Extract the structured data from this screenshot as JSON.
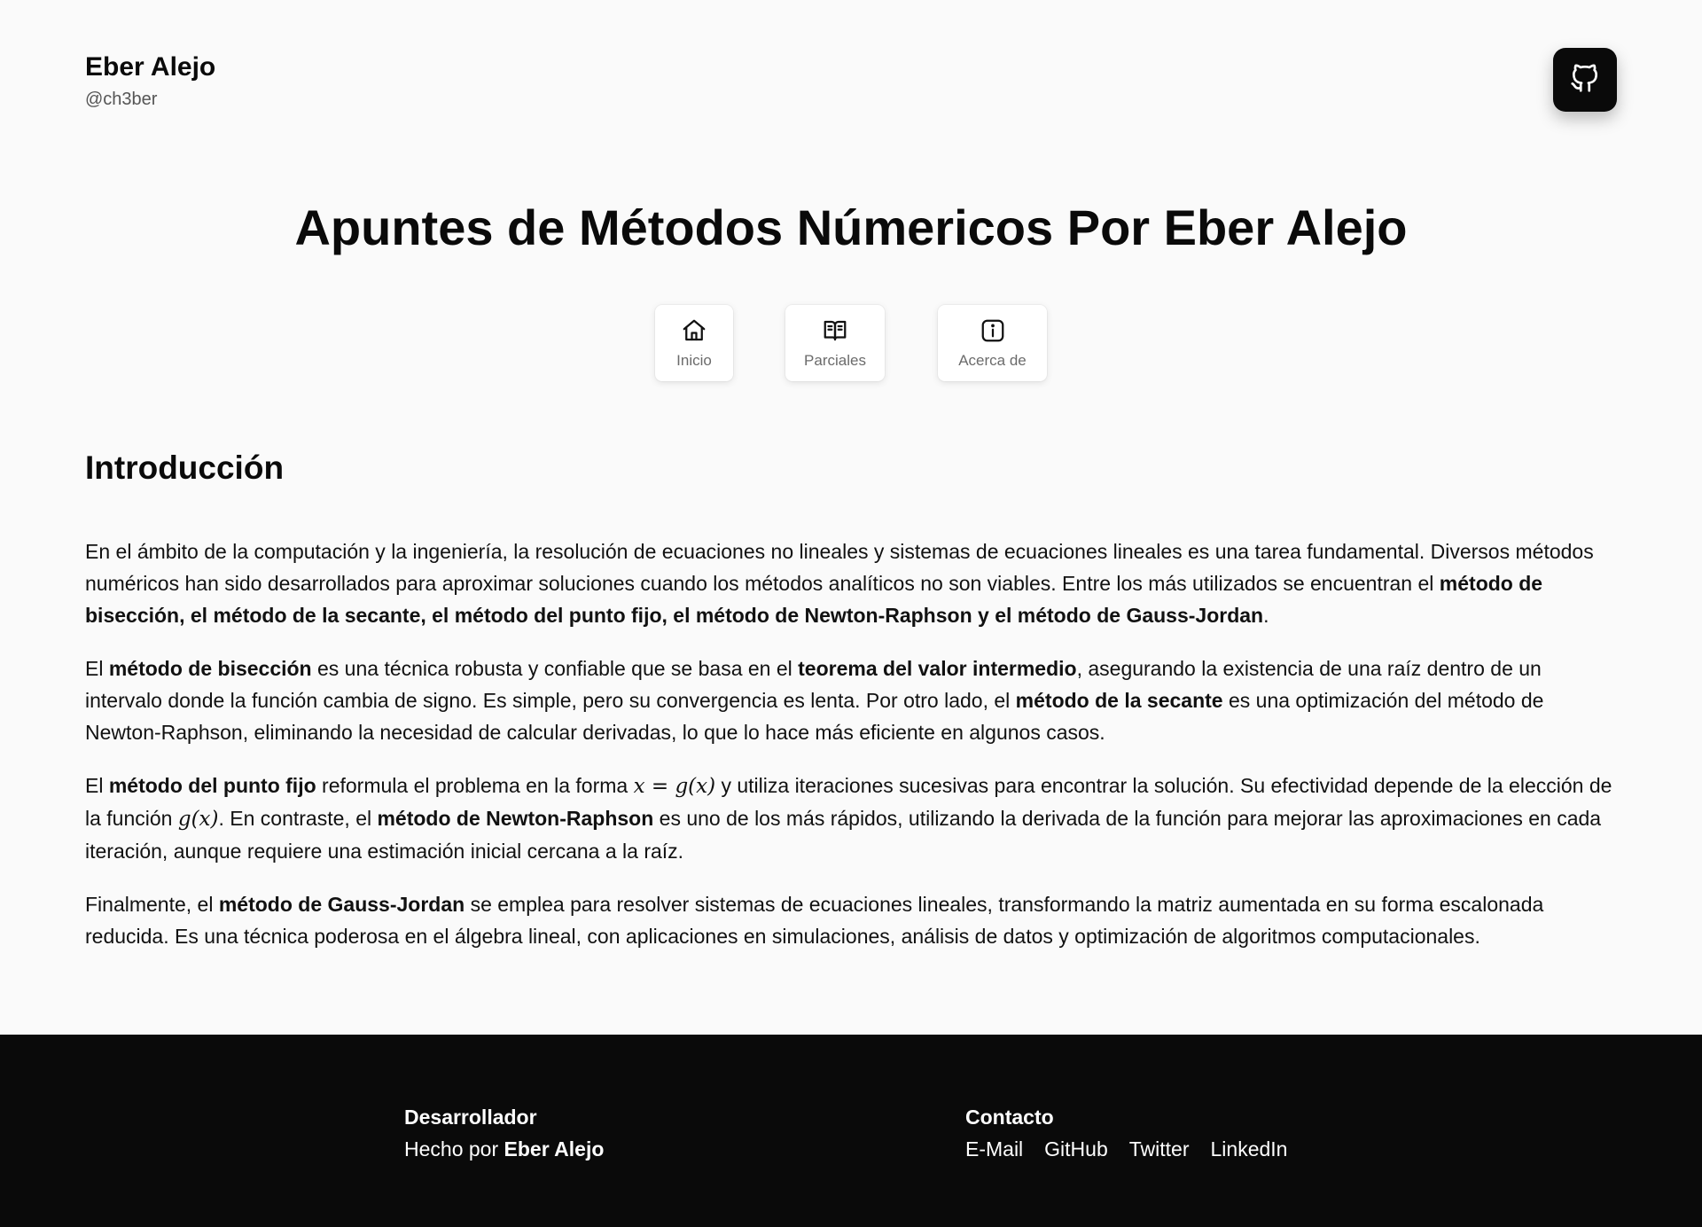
{
  "header": {
    "name": "Eber Alejo",
    "handle": "@ch3ber",
    "github_icon": "github-icon"
  },
  "hero": {
    "title": "Apuntes de Métodos Númericos Por Eber Alejo"
  },
  "nav": {
    "items": [
      {
        "label": "Inicio",
        "icon": "home-icon"
      },
      {
        "label": "Parciales",
        "icon": "book-open-icon"
      },
      {
        "label": "Acerca de",
        "icon": "info-icon"
      }
    ]
  },
  "intro": {
    "title": "Introducción",
    "p1": {
      "t1": "En el ámbito de la computación y la ingeniería, la resolución de ecuaciones no lineales y sistemas de ecuaciones lineales es una tarea fundamental. Diversos métodos numéricos han sido desarrollados para aproximar soluciones cuando los métodos analíticos no son viables. Entre los más utilizados se encuentran el ",
      "b1": "método de bisección, el método de la secante, el método del punto fijo, el método de Newton-Raphson y el método de Gauss-Jordan",
      "t2": "."
    },
    "p2": {
      "t1": "El ",
      "b1": "método de bisección",
      "t2": " es una técnica robusta y confiable que se basa en el ",
      "b2": "teorema del valor intermedio",
      "t3": ", asegurando la existencia de una raíz dentro de un intervalo donde la función cambia de signo. Es simple, pero su convergencia es lenta. Por otro lado, el ",
      "b3": "método de la secante",
      "t4": " es una optimización del método de Newton-Raphson, eliminando la necesidad de calcular derivadas, lo que lo hace más eficiente en algunos casos."
    },
    "p3": {
      "t1": "El ",
      "b1": "método del punto fijo",
      "t2": " reformula el problema en la forma ",
      "m1": "x = g(x)",
      "t3": " y utiliza iteraciones sucesivas para encontrar la solución. Su efectividad depende de la elección de la función ",
      "m2": "g(x)",
      "t4": ". En contraste, el ",
      "b2": "método de Newton-Raphson",
      "t5": " es uno de los más rápidos, utilizando la derivada de la función para mejorar las aproximaciones en cada iteración, aunque requiere una estimación inicial cercana a la raíz."
    },
    "p4": {
      "t1": "Finalmente, el ",
      "b1": "método de Gauss-Jordan",
      "t2": " se emplea para resolver sistemas de ecuaciones lineales, transformando la matriz aumentada en su forma escalonada reducida. Es una técnica poderosa en el álgebra lineal, con aplicaciones en simulaciones, análisis de datos y optimización de algoritmos computacionales."
    }
  },
  "footer": {
    "dev_heading": "Desarrollador",
    "made_by": "Hecho por ",
    "author": "Eber Alejo",
    "contact_heading": "Contacto",
    "links": [
      "E-Mail",
      "GitHub",
      "Twitter",
      "LinkedIn"
    ]
  }
}
